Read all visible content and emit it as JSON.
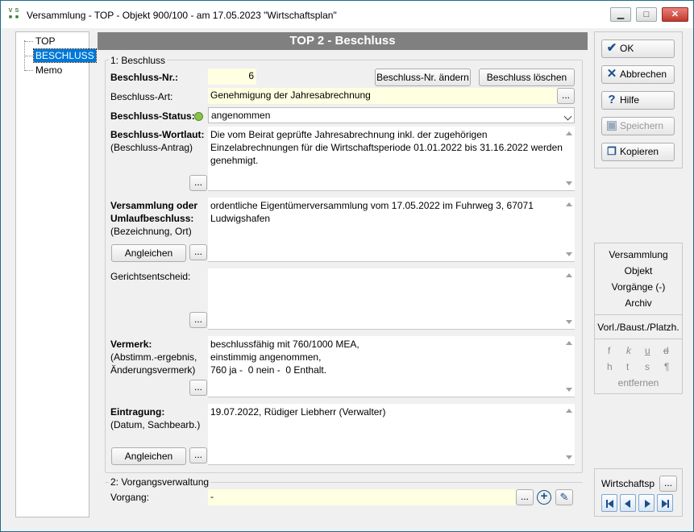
{
  "window": {
    "title": "Versammlung - TOP - Objekt 900/100 - am 17.05.2023 \"Wirtschaftsplan\"",
    "icon_text": "VS"
  },
  "tree": {
    "items": [
      {
        "label": "TOP"
      },
      {
        "label": "BESCHLUSS"
      },
      {
        "label": "Memo"
      }
    ],
    "selected": "BESCHLUSS"
  },
  "header": {
    "title": "TOP 2 - Beschluss"
  },
  "group1": {
    "label": "1: Beschluss"
  },
  "group2": {
    "label": "2: Vorgangsverwaltung"
  },
  "beschluss_nr": {
    "label": "Beschluss-Nr.:",
    "value": "6"
  },
  "buttons": {
    "nr_aendern": "Beschluss-Nr. ändern",
    "loeschen": "Beschluss löschen",
    "angleichen": "Angleichen",
    "dots": "..."
  },
  "beschluss_art": {
    "label": "Beschluss-Art:",
    "value": "Genehmigung der Jahresabrechnung"
  },
  "beschluss_status": {
    "label": "Beschluss-Status:",
    "value": "angenommen",
    "indicator_color": "#8bc34a"
  },
  "wortlaut": {
    "label": "Beschluss-Wortlaut:",
    "sublabel": "(Beschluss-Antrag)",
    "text": "Die vom Beirat geprüfte Jahresabrechnung inkl. der zugehörigen\nEinzelabrechnungen für die Wirtschaftsperiode 01.01.2022 bis 31.16.2022 werden\ngenehmigt."
  },
  "versammlung": {
    "label1": "Versammlung oder",
    "label2": "Umlaufbeschluss:",
    "sublabel": "(Bezeichnung, Ort)",
    "text": "ordentliche Eigentümerversammlung vom 17.05.2022 im Fuhrweg 3, 67071\nLudwigshafen"
  },
  "gericht": {
    "label": "Gerichtsentscheid:",
    "text": ""
  },
  "vermerk": {
    "label": "Vermerk:",
    "sublabel1": "(Abstimm.-ergebnis,",
    "sublabel2": "Änderungsvermerk)",
    "text": "beschlussfähig mit 760/1000 MEA,\neinstimmig angenommen,\n760 ja -  0 nein -  0 Enthalt."
  },
  "eintragung": {
    "label": "Eintragung:",
    "sublabel": "(Datum, Sachbearb.)",
    "text": "19.07.2022, Rüdiger Liebherr (Verwalter)"
  },
  "vorgang": {
    "label": "Vorgang:",
    "value": "-"
  },
  "actions": {
    "ok": "OK",
    "abbrechen": "Abbrechen",
    "hilfe": "Hilfe",
    "speichern": "Speichern",
    "kopieren": "Kopieren"
  },
  "nav": {
    "versammlung": "Versammlung",
    "objekt": "Objekt",
    "vorgaenge": "Vorgänge (-)",
    "archiv": "Archiv",
    "vorl": "Vorl./Baust./Platzh."
  },
  "format": {
    "row1": [
      "f",
      "k",
      "u",
      "d"
    ],
    "row2": [
      "h",
      "t",
      "s",
      "¶"
    ],
    "entfernen": "entfernen"
  },
  "bottom": {
    "wirtschaftsplan": "Wirtschaftsp"
  },
  "colors": {
    "header_bg": "#808080",
    "yellow_field": "#ffffe1",
    "selection": "#0078d7"
  }
}
